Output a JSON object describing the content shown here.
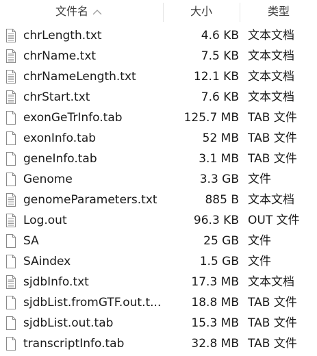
{
  "header": {
    "name_label": "文件名",
    "size_label": "大小",
    "type_label": "类型",
    "sort_icon": "chevron-up-icon"
  },
  "files": [
    {
      "name": "chrLength.txt",
      "size": "4.6 KB",
      "type": "文本文档",
      "icon": "text-document-icon"
    },
    {
      "name": "chrName.txt",
      "size": "7.5 KB",
      "type": "文本文档",
      "icon": "text-document-icon"
    },
    {
      "name": "chrNameLength.txt",
      "size": "12.1 KB",
      "type": "文本文档",
      "icon": "text-document-icon"
    },
    {
      "name": "chrStart.txt",
      "size": "7.6 KB",
      "type": "文本文档",
      "icon": "text-document-icon"
    },
    {
      "name": "exonGeTrInfo.tab",
      "size": "125.7 MB",
      "type": "TAB 文件",
      "icon": "blank-file-icon"
    },
    {
      "name": "exonInfo.tab",
      "size": "52 MB",
      "type": "TAB 文件",
      "icon": "blank-file-icon"
    },
    {
      "name": "geneInfo.tab",
      "size": "3.1 MB",
      "type": "TAB 文件",
      "icon": "blank-file-icon"
    },
    {
      "name": "Genome",
      "size": "3.3 GB",
      "type": "文件",
      "icon": "blank-file-icon"
    },
    {
      "name": "genomeParameters.txt",
      "size": "885 B",
      "type": "文本文档",
      "icon": "text-document-icon"
    },
    {
      "name": "Log.out",
      "size": "96.3 KB",
      "type": "OUT 文件",
      "icon": "text-document-icon"
    },
    {
      "name": "SA",
      "size": "25 GB",
      "type": "文件",
      "icon": "blank-file-icon"
    },
    {
      "name": "SAindex",
      "size": "1.5 GB",
      "type": "文件",
      "icon": "blank-file-icon"
    },
    {
      "name": "sjdbInfo.txt",
      "size": "17.3 MB",
      "type": "文本文档",
      "icon": "text-document-icon"
    },
    {
      "name": "sjdbList.fromGTF.out.t...",
      "size": "18.8 MB",
      "type": "TAB 文件",
      "icon": "blank-file-icon"
    },
    {
      "name": "sjdbList.out.tab",
      "size": "15.3 MB",
      "type": "TAB 文件",
      "icon": "blank-file-icon"
    },
    {
      "name": "transcriptInfo.tab",
      "size": "32.8 MB",
      "type": "TAB 文件",
      "icon": "blank-file-icon"
    }
  ]
}
